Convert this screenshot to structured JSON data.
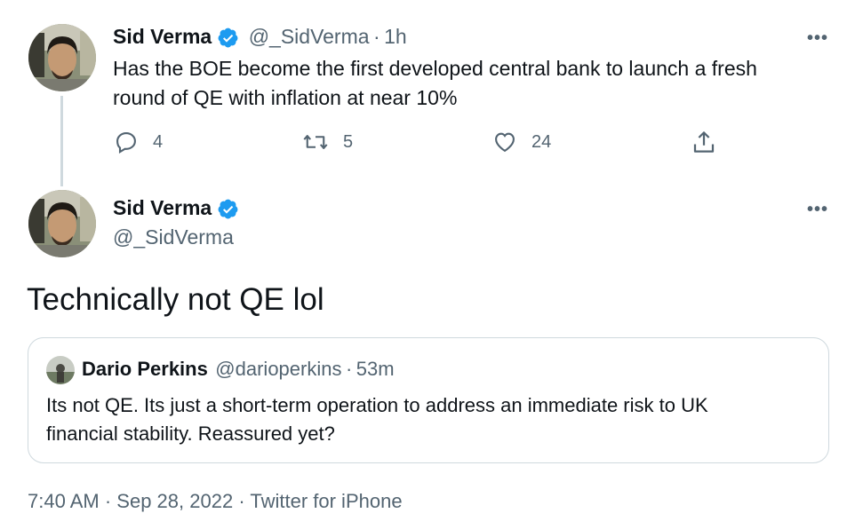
{
  "tweet1": {
    "name": "Sid Verma",
    "handle": "@_SidVerma",
    "time": "1h",
    "text_line1": "Has the BOE become the first developed central bank to launch a fresh",
    "text_line2": "round of QE with inflation at near 10%",
    "replies": "4",
    "retweets": "5",
    "likes": "24",
    "more": "•••"
  },
  "tweet2": {
    "name": "Sid Verma",
    "handle": "@_SidVerma",
    "text": "Technically not QE lol",
    "more": "•••"
  },
  "quote": {
    "name": "Dario Perkins",
    "handle": "@darioperkins",
    "time": "53m",
    "text_line1": "Its not QE. Its just a short-term operation to address an immediate risk to UK",
    "text_line2": "financial stability. Reassured yet?"
  },
  "footer": {
    "time": "7:40 AM",
    "date": "Sep 28, 2022",
    "source": "Twitter for iPhone"
  },
  "separator": "·",
  "colors": {
    "verified": "#1d9bf0",
    "secondary_text": "#536471",
    "primary_text": "#0f1419",
    "border": "#cfd9de"
  }
}
